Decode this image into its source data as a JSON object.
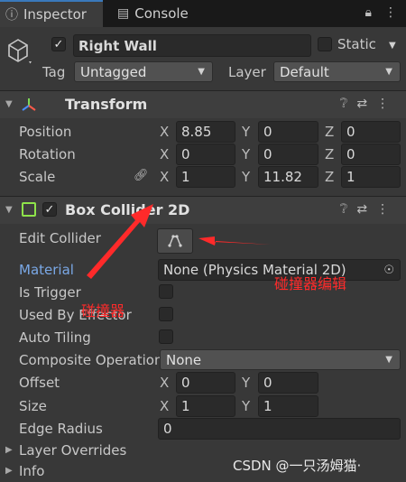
{
  "tabs": [
    {
      "label": "Inspector",
      "icon": "info-icon"
    },
    {
      "label": "Console",
      "icon": "console-icon"
    }
  ],
  "gameobject": {
    "name": "Right Wall",
    "active": true,
    "static_label": "Static",
    "static": false,
    "tag_label": "Tag",
    "tag_value": "Untagged",
    "layer_label": "Layer",
    "layer_value": "Default"
  },
  "transform": {
    "title": "Transform",
    "position": {
      "label": "Position",
      "x": "8.85",
      "y": "0",
      "z": "0"
    },
    "rotation": {
      "label": "Rotation",
      "x": "0",
      "y": "0",
      "z": "0"
    },
    "scale": {
      "label": "Scale",
      "x": "1",
      "y": "11.82",
      "z": "1"
    }
  },
  "axes": {
    "x": "X",
    "y": "Y",
    "z": "Z"
  },
  "box_collider": {
    "title": "Box Collider 2D",
    "enabled": true,
    "edit_collider_label": "Edit Collider",
    "material_label": "Material",
    "material_value": "None (Physics Material 2D)",
    "is_trigger_label": "Is Trigger",
    "used_by_effector_label": "Used By Effector",
    "auto_tiling_label": "Auto Tiling",
    "composite_label": "Composite Operation",
    "composite_value": "None",
    "offset_label": "Offset",
    "offset": {
      "x": "0",
      "y": "0"
    },
    "size_label": "Size",
    "size": {
      "x": "1",
      "y": "1"
    },
    "edge_radius_label": "Edge Radius",
    "edge_radius": "0",
    "layer_overrides_label": "Layer Overrides",
    "info_label": "Info"
  },
  "annotations": {
    "collider_cn": "碰撞器",
    "collider_edit_cn": "碰撞器编辑",
    "watermark": "CSDN @一只汤姆猫·"
  },
  "colors": {
    "annotation_red": "#ff2a2a",
    "selected_tab_accent": "#3a79bb",
    "material_label": "#7aa8e6"
  }
}
